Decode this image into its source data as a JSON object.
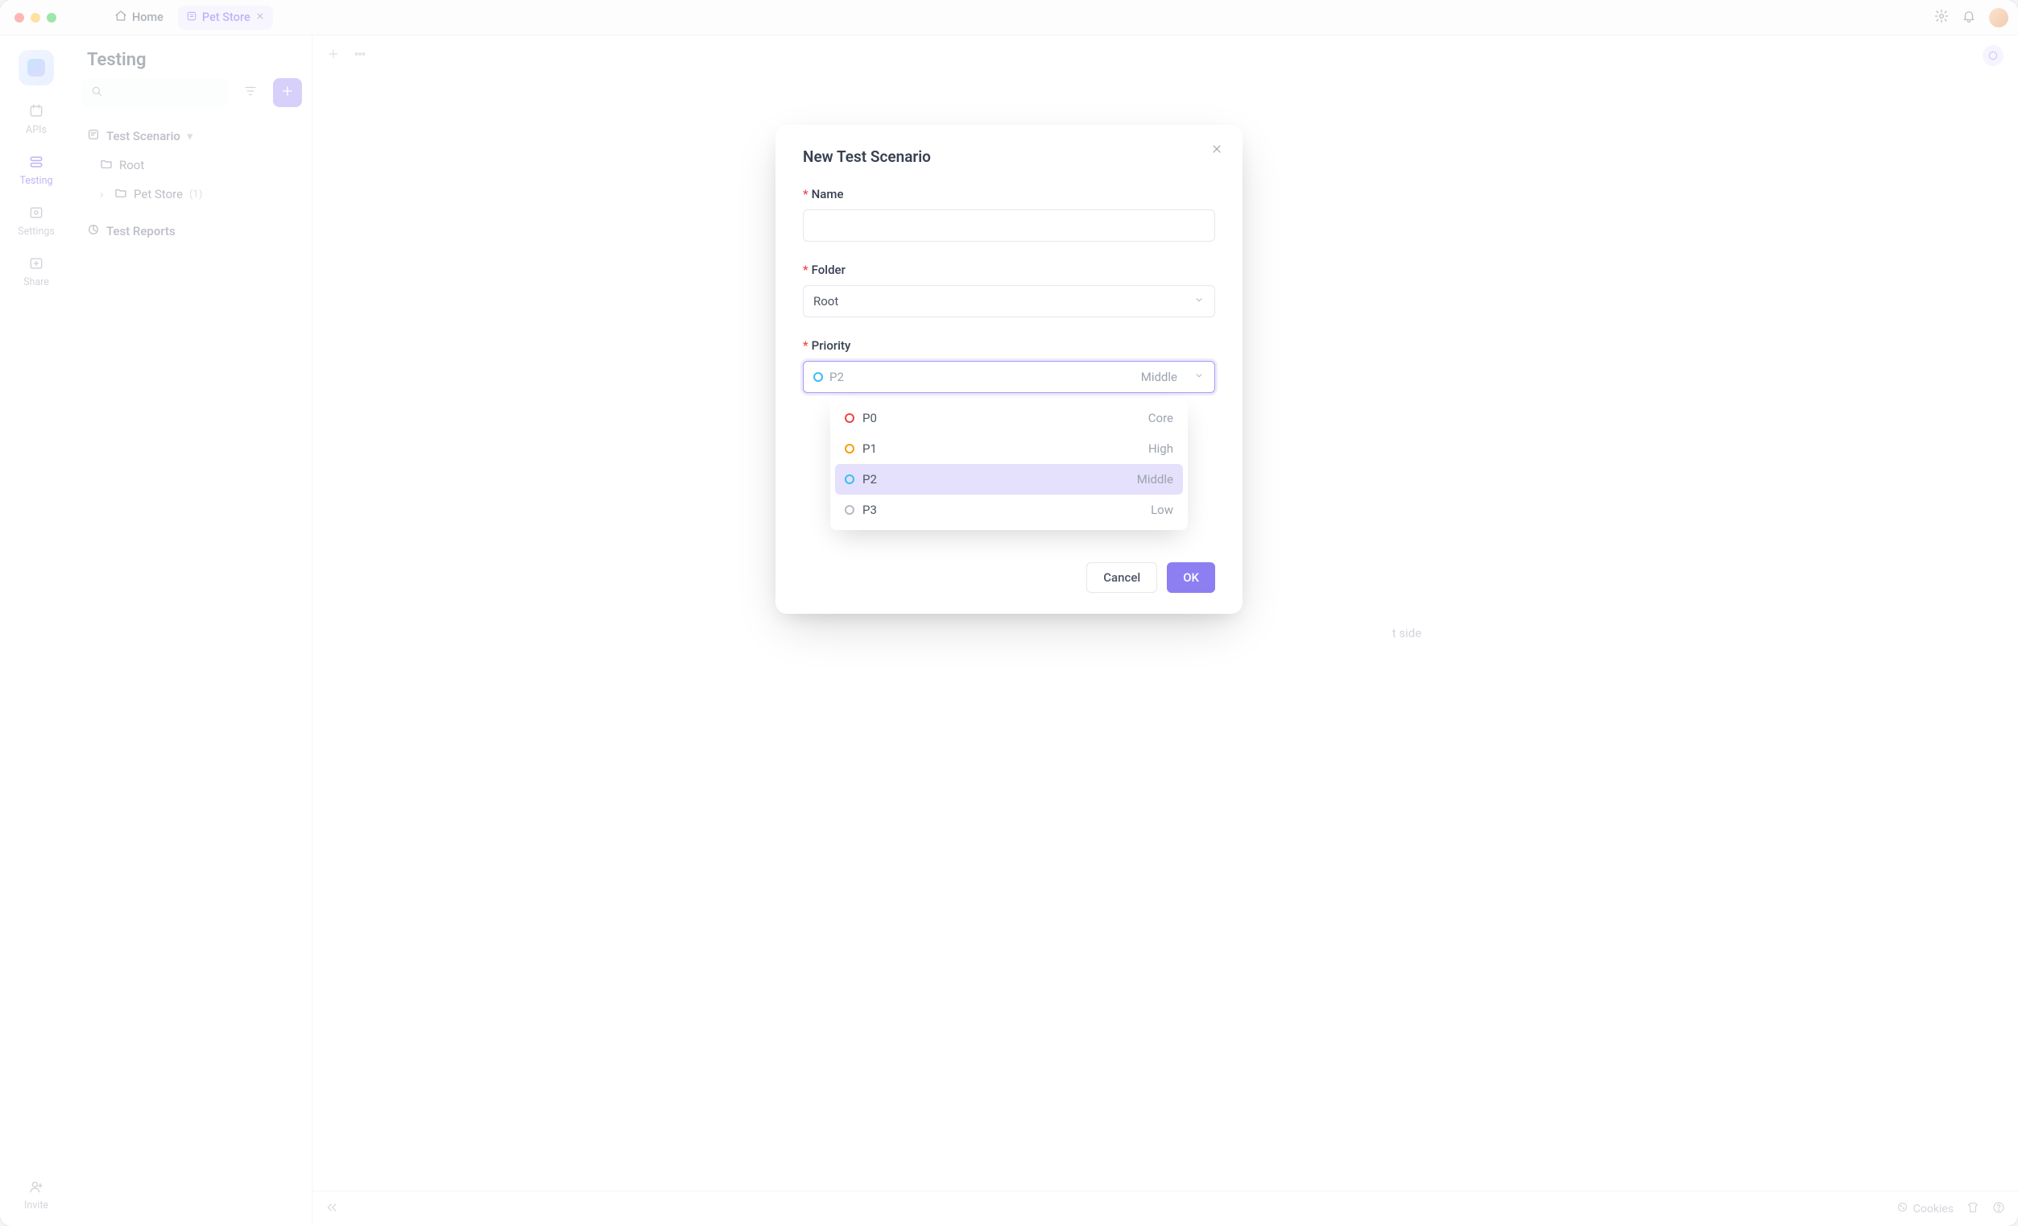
{
  "titlebar": {
    "home_label": "Home",
    "active_tab_label": "Pet Store"
  },
  "rail": {
    "apis": "APIs",
    "testing": "Testing",
    "settings": "Settings",
    "share": "Share",
    "invite": "Invite"
  },
  "sidepanel": {
    "title": "Testing",
    "tree": {
      "section_label": "Test Scenario",
      "root_label": "Root",
      "petstore_label": "Pet Store",
      "petstore_count": "(1)",
      "reports_label": "Test Reports"
    }
  },
  "canvas": {
    "hint_text": "t side"
  },
  "footer": {
    "cookies": "Cookies"
  },
  "modal": {
    "title": "New Test Scenario",
    "name_label": "Name",
    "folder_label": "Folder",
    "folder_value": "Root",
    "priority_label": "Priority",
    "priority_value_code": "P2",
    "priority_value_level": "Middle",
    "options": [
      {
        "code": "P0",
        "level": "Core",
        "color": "c-red"
      },
      {
        "code": "P1",
        "level": "High",
        "color": "c-orange"
      },
      {
        "code": "P2",
        "level": "Middle",
        "color": "c-blue"
      },
      {
        "code": "P3",
        "level": "Low",
        "color": "c-gray"
      }
    ],
    "cancel": "Cancel",
    "ok": "OK"
  }
}
